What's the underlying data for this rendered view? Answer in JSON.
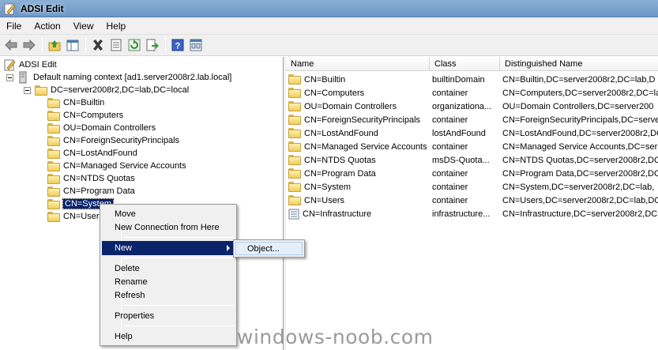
{
  "window": {
    "title": "ADSI Edit"
  },
  "menu": [
    "File",
    "Action",
    "View",
    "Help"
  ],
  "toolbar": {
    "buttons": [
      "back-arrow-icon",
      "forward-arrow-icon",
      "up-folder-icon",
      "show-hide-tree-icon",
      "delete-x-icon",
      "properties-icon",
      "refresh-icon",
      "export-list-icon",
      "help-icon",
      "console-tree-icon"
    ]
  },
  "tree": {
    "root": "ADSI Edit",
    "context": "Default naming context [ad1.server2008r2.lab.local]",
    "domain": "DC=server2008r2,DC=lab,DC=local",
    "children": [
      "CN=Builtin",
      "CN=Computers",
      "OU=Domain Controllers",
      "CN=ForeignSecurityPrincipals",
      "CN=LostAndFound",
      "CN=Managed Service Accounts",
      "CN=NTDS Quotas",
      "CN=Program Data",
      "CN=System",
      "CN=Users"
    ],
    "selected": "CN=System"
  },
  "list": {
    "columns": [
      "Name",
      "Class",
      "Distinguished Name"
    ],
    "rows": [
      {
        "name": "CN=Builtin",
        "class": "builtinDomain",
        "dn": "CN=Builtin,DC=server2008r2,DC=lab,D"
      },
      {
        "name": "CN=Computers",
        "class": "container",
        "dn": "CN=Computers,DC=server2008r2,DC=la"
      },
      {
        "name": "OU=Domain Controllers",
        "class": "organizationa...",
        "dn": "OU=Domain Controllers,DC=server200"
      },
      {
        "name": "CN=ForeignSecurityPrincipals",
        "class": "container",
        "dn": "CN=ForeignSecurityPrincipals,DC=serve"
      },
      {
        "name": "CN=LostAndFound",
        "class": "lostAndFound",
        "dn": "CN=LostAndFound,DC=server2008r2,DC"
      },
      {
        "name": "CN=Managed Service Accounts",
        "class": "container",
        "dn": "CN=Managed Service Accounts,DC=ser"
      },
      {
        "name": "CN=NTDS Quotas",
        "class": "msDS-Quota...",
        "dn": "CN=NTDS Quotas,DC=server2008r2,DC"
      },
      {
        "name": "CN=Program Data",
        "class": "container",
        "dn": "CN=Program Data,DC=server2008r2,DC"
      },
      {
        "name": "CN=System",
        "class": "container",
        "dn": "CN=System,DC=server2008r2,DC=lab,"
      },
      {
        "name": "CN=Users",
        "class": "container",
        "dn": "CN=Users,DC=server2008r2,DC=lab,DC"
      },
      {
        "name": "CN=Infrastructure",
        "class": "infrastructure...",
        "dn": "CN=Infrastructure,DC=server2008r2,DC"
      }
    ]
  },
  "context_menu": {
    "items": [
      "Move",
      "New Connection from Here",
      "New",
      "Delete",
      "Rename",
      "Refresh",
      "Properties",
      "Help"
    ],
    "highlighted": "New"
  },
  "submenu": {
    "items": [
      "Object..."
    ]
  },
  "watermark": "windows-noob.com",
  "colors": {
    "selection": "#0a246a",
    "titlebar": "#7aa3d0",
    "folder": "#f0cd5c"
  }
}
